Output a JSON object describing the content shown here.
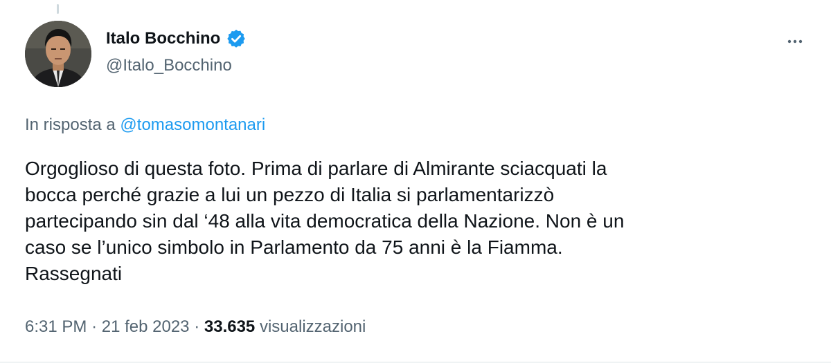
{
  "author": {
    "display_name": "Italo Bocchino",
    "handle": "@Italo_Bocchino",
    "verified_icon": "verified-badge-icon"
  },
  "reply": {
    "prefix": "In risposta a",
    "to_handle": "@tomasomontanari"
  },
  "tweet": {
    "text": "Orgoglioso di questa foto. Prima di parlare di Almirante sciacquati la\nbocca perché grazie a lui un pezzo di Italia si parlamentarizzò\npartecipando sin dal ‘48 alla vita democratica della Nazione. Non è un\ncaso se l’unico simbolo in Parlamento da 75 anni è la Fiamma.\nRassegnati"
  },
  "meta": {
    "time": "6:31 PM",
    "separator": "·",
    "date": "21 feb 2023",
    "views_count": "33.635",
    "views_label": "visualizzazioni"
  },
  "colors": {
    "accent": "#1d9bf0",
    "secondary_text": "#536471",
    "primary_text": "#0f1419"
  }
}
